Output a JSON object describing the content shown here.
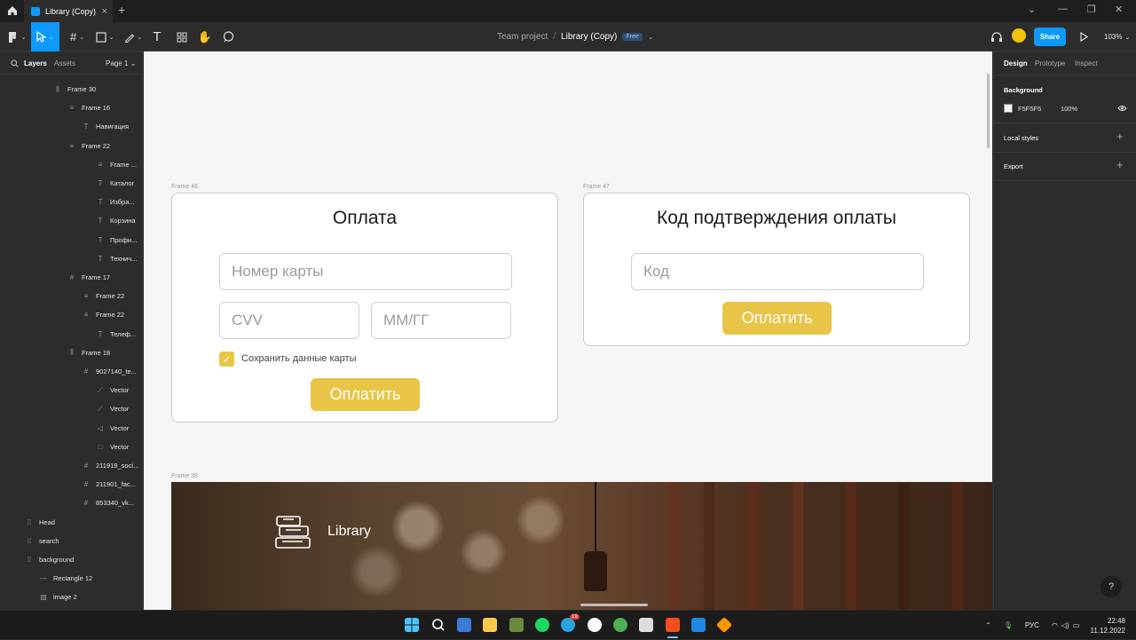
{
  "tab": {
    "title": "Library (Copy)",
    "close": "×",
    "plus": "+"
  },
  "window": {
    "minimize": "⌄",
    "min": "—",
    "max": "❐",
    "close": "✕"
  },
  "breadcrumb": {
    "team": "Team project",
    "sep": "/",
    "file": "Library (Copy)",
    "badge": "Free",
    "chevron": "⌄"
  },
  "toolbar": {
    "share": "Share",
    "zoom": "103%",
    "zoom_chevron": "⌄"
  },
  "left_panel": {
    "tabs": {
      "layers": "Layers",
      "assets": "Assets",
      "page": "Page 1 ⌄"
    },
    "layers": [
      {
        "label": "Frame 30",
        "icon": "frame-icon",
        "glyph": "⫼"
      },
      {
        "label": "Frame 16",
        "icon": "auto-layout-icon",
        "glyph": "≡"
      },
      {
        "label": "Навигация",
        "icon": "text-icon",
        "glyph": "T"
      },
      {
        "label": "Frame 22",
        "icon": "auto-layout-icon",
        "glyph": "≡"
      },
      {
        "label": "Frame ...",
        "icon": "auto-layout-icon",
        "glyph": "≡"
      },
      {
        "label": "Каталог",
        "icon": "text-icon",
        "glyph": "T"
      },
      {
        "label": "Избра...",
        "icon": "text-icon",
        "glyph": "T"
      },
      {
        "label": "Корзина",
        "icon": "text-icon",
        "glyph": "T"
      },
      {
        "label": "Профи...",
        "icon": "text-icon",
        "glyph": "T"
      },
      {
        "label": "Технич...",
        "icon": "text-icon",
        "glyph": "T"
      },
      {
        "label": "Frame 17",
        "icon": "frame-icon",
        "glyph": "#"
      },
      {
        "label": "Frame 22",
        "icon": "auto-layout-icon",
        "glyph": "≡"
      },
      {
        "label": "Frame 22",
        "icon": "auto-layout-icon",
        "glyph": "≡"
      },
      {
        "label": "Телеф...",
        "icon": "text-icon",
        "glyph": "T"
      },
      {
        "label": "Frame 18",
        "icon": "frame-icon",
        "glyph": "⫼"
      },
      {
        "label": "9027140_te...",
        "icon": "frame-icon",
        "glyph": "#"
      },
      {
        "label": "Vector",
        "icon": "vector-icon",
        "glyph": "⟋"
      },
      {
        "label": "Vector",
        "icon": "vector-icon",
        "glyph": "⟋"
      },
      {
        "label": "Vector",
        "icon": "vector-icon",
        "glyph": "◁"
      },
      {
        "label": "Vector",
        "icon": "vector-icon",
        "glyph": "□"
      },
      {
        "label": "211919_soci...",
        "icon": "frame-icon",
        "glyph": "#"
      },
      {
        "label": "211901_fac...",
        "icon": "frame-icon",
        "glyph": "#"
      },
      {
        "label": "853340_vk...",
        "icon": "frame-icon",
        "glyph": "#"
      },
      {
        "label": "Head",
        "icon": "component-icon",
        "glyph": "⁞⁞"
      },
      {
        "label": "search",
        "icon": "component-icon",
        "glyph": "⁞⁞"
      },
      {
        "label": "background",
        "icon": "component-icon",
        "glyph": "⁞⁞"
      },
      {
        "label": "Rectangle 12",
        "icon": "line-icon",
        "glyph": "—"
      },
      {
        "label": "image 2",
        "icon": "image-icon",
        "glyph": "▨"
      }
    ]
  },
  "canvas": {
    "frame46": {
      "label": "Frame 46",
      "title": "Оплата",
      "card_placeholder": "Номер карты",
      "cvv_placeholder": "CVV",
      "date_placeholder": "ММ/ГГ",
      "save_label": "Сохранить данные карты",
      "save_checked": true,
      "button": "Оплатить"
    },
    "frame47": {
      "label": "Frame 47",
      "title": "Код подтверждения оплаты",
      "code_placeholder": "Код",
      "button": "Оплатить"
    },
    "frame38": {
      "label": "Frame 38",
      "brand": "Library"
    }
  },
  "right_panel": {
    "tabs": {
      "design": "Design",
      "prototype": "Prototype",
      "inspect": "Inspect"
    },
    "background_label": "Background",
    "background_hex": "F5F5F5",
    "background_opacity": "100%",
    "local_styles": "Local styles",
    "export": "Export",
    "plus": "+"
  },
  "help": "?",
  "taskbar": {
    "lang": "РУС",
    "time": "22:48",
    "date": "11.12.2022",
    "telegram_badge": "19"
  },
  "colors": {
    "accent": "#0d99ff",
    "pay_button": "#e8c547",
    "canvas_bg": "#F5F5F5"
  }
}
